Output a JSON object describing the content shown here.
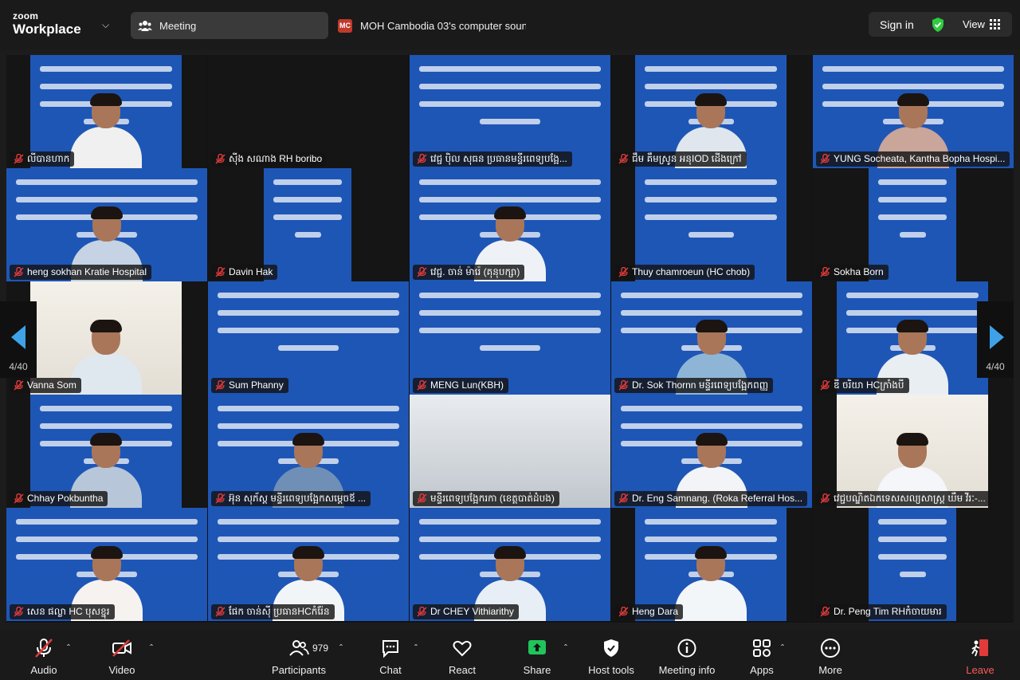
{
  "topbar": {
    "brand_small": "zoom",
    "brand_large": "Workplace",
    "meeting_label": "Meeting",
    "share_badge": "MC",
    "share_text": "MOH Cambodia 03's computer sound",
    "signin_label": "Sign in",
    "view_label": "View",
    "shield_color": "#2ecc40"
  },
  "gallery": {
    "page_left": "4/40",
    "page_right": "4/40",
    "accent_arrow": "#3fa2e8",
    "participants": [
      "លីបានហាក",
      "សុីង សណាង RH boribo",
      "វេជ្ជ ប៉ិល សុធន ប្រធានមន្ទីរពេទ្យបង្អែ...",
      "ជឹម គឹមស្រូន អនុIOD ដើងក្រៅ",
      "YUNG Socheata, Kantha Bopha Hospi...",
      "heng sokhan Kratie Hospital",
      "Davin Hak",
      "វេជ្ជ. ចាន់ ម៉ារ៉េ (គុនុបក្សា)",
      "Thuy chamroeun (HC chob)",
      "Sokha Born",
      "Vanna Som",
      "Sum Phanny",
      "MENG Lun(KBH)",
      "Dr. Sok Thornn មន្ទីរពេទ្យបង្អែកពញ្ញ",
      "ឌី ចរិយា HCក្រាំងបី",
      "Chhay Pokbuntha",
      "អ៊ុន សុភ័ស្ត មន្ទីរពេទ្យបង្អែកសម្ដេចឪ ...",
      "មន្ទីរពេទ្យបង្អែករកា (ខេត្តបាត់ដំបង)",
      "Dr. Eng Samnang. (Roka Referral Hos...",
      "វេជ្ជបណ្ឌិតឯកទេសសល្យសាស្ត្រ ឃឹម វីរៈ-...",
      "សេន ផល្លា HC បុសខ្នុរ",
      "ផែក ចាន់សុី ប្រធានHCកំរ៉ែន",
      "Dr CHEY Vithiarithy",
      "Heng Dara",
      "Dr. Peng Tim RHកំចាយមារ"
    ]
  },
  "toolbar": {
    "audio": "Audio",
    "video": "Video",
    "participants": "Participants",
    "participants_count": "979",
    "chat": "Chat",
    "react": "React",
    "share": "Share",
    "host_tools": "Host tools",
    "meeting_info": "Meeting info",
    "apps": "Apps",
    "more": "More",
    "leave": "Leave",
    "share_color": "#21c35b",
    "leave_color": "#e03a3a"
  }
}
